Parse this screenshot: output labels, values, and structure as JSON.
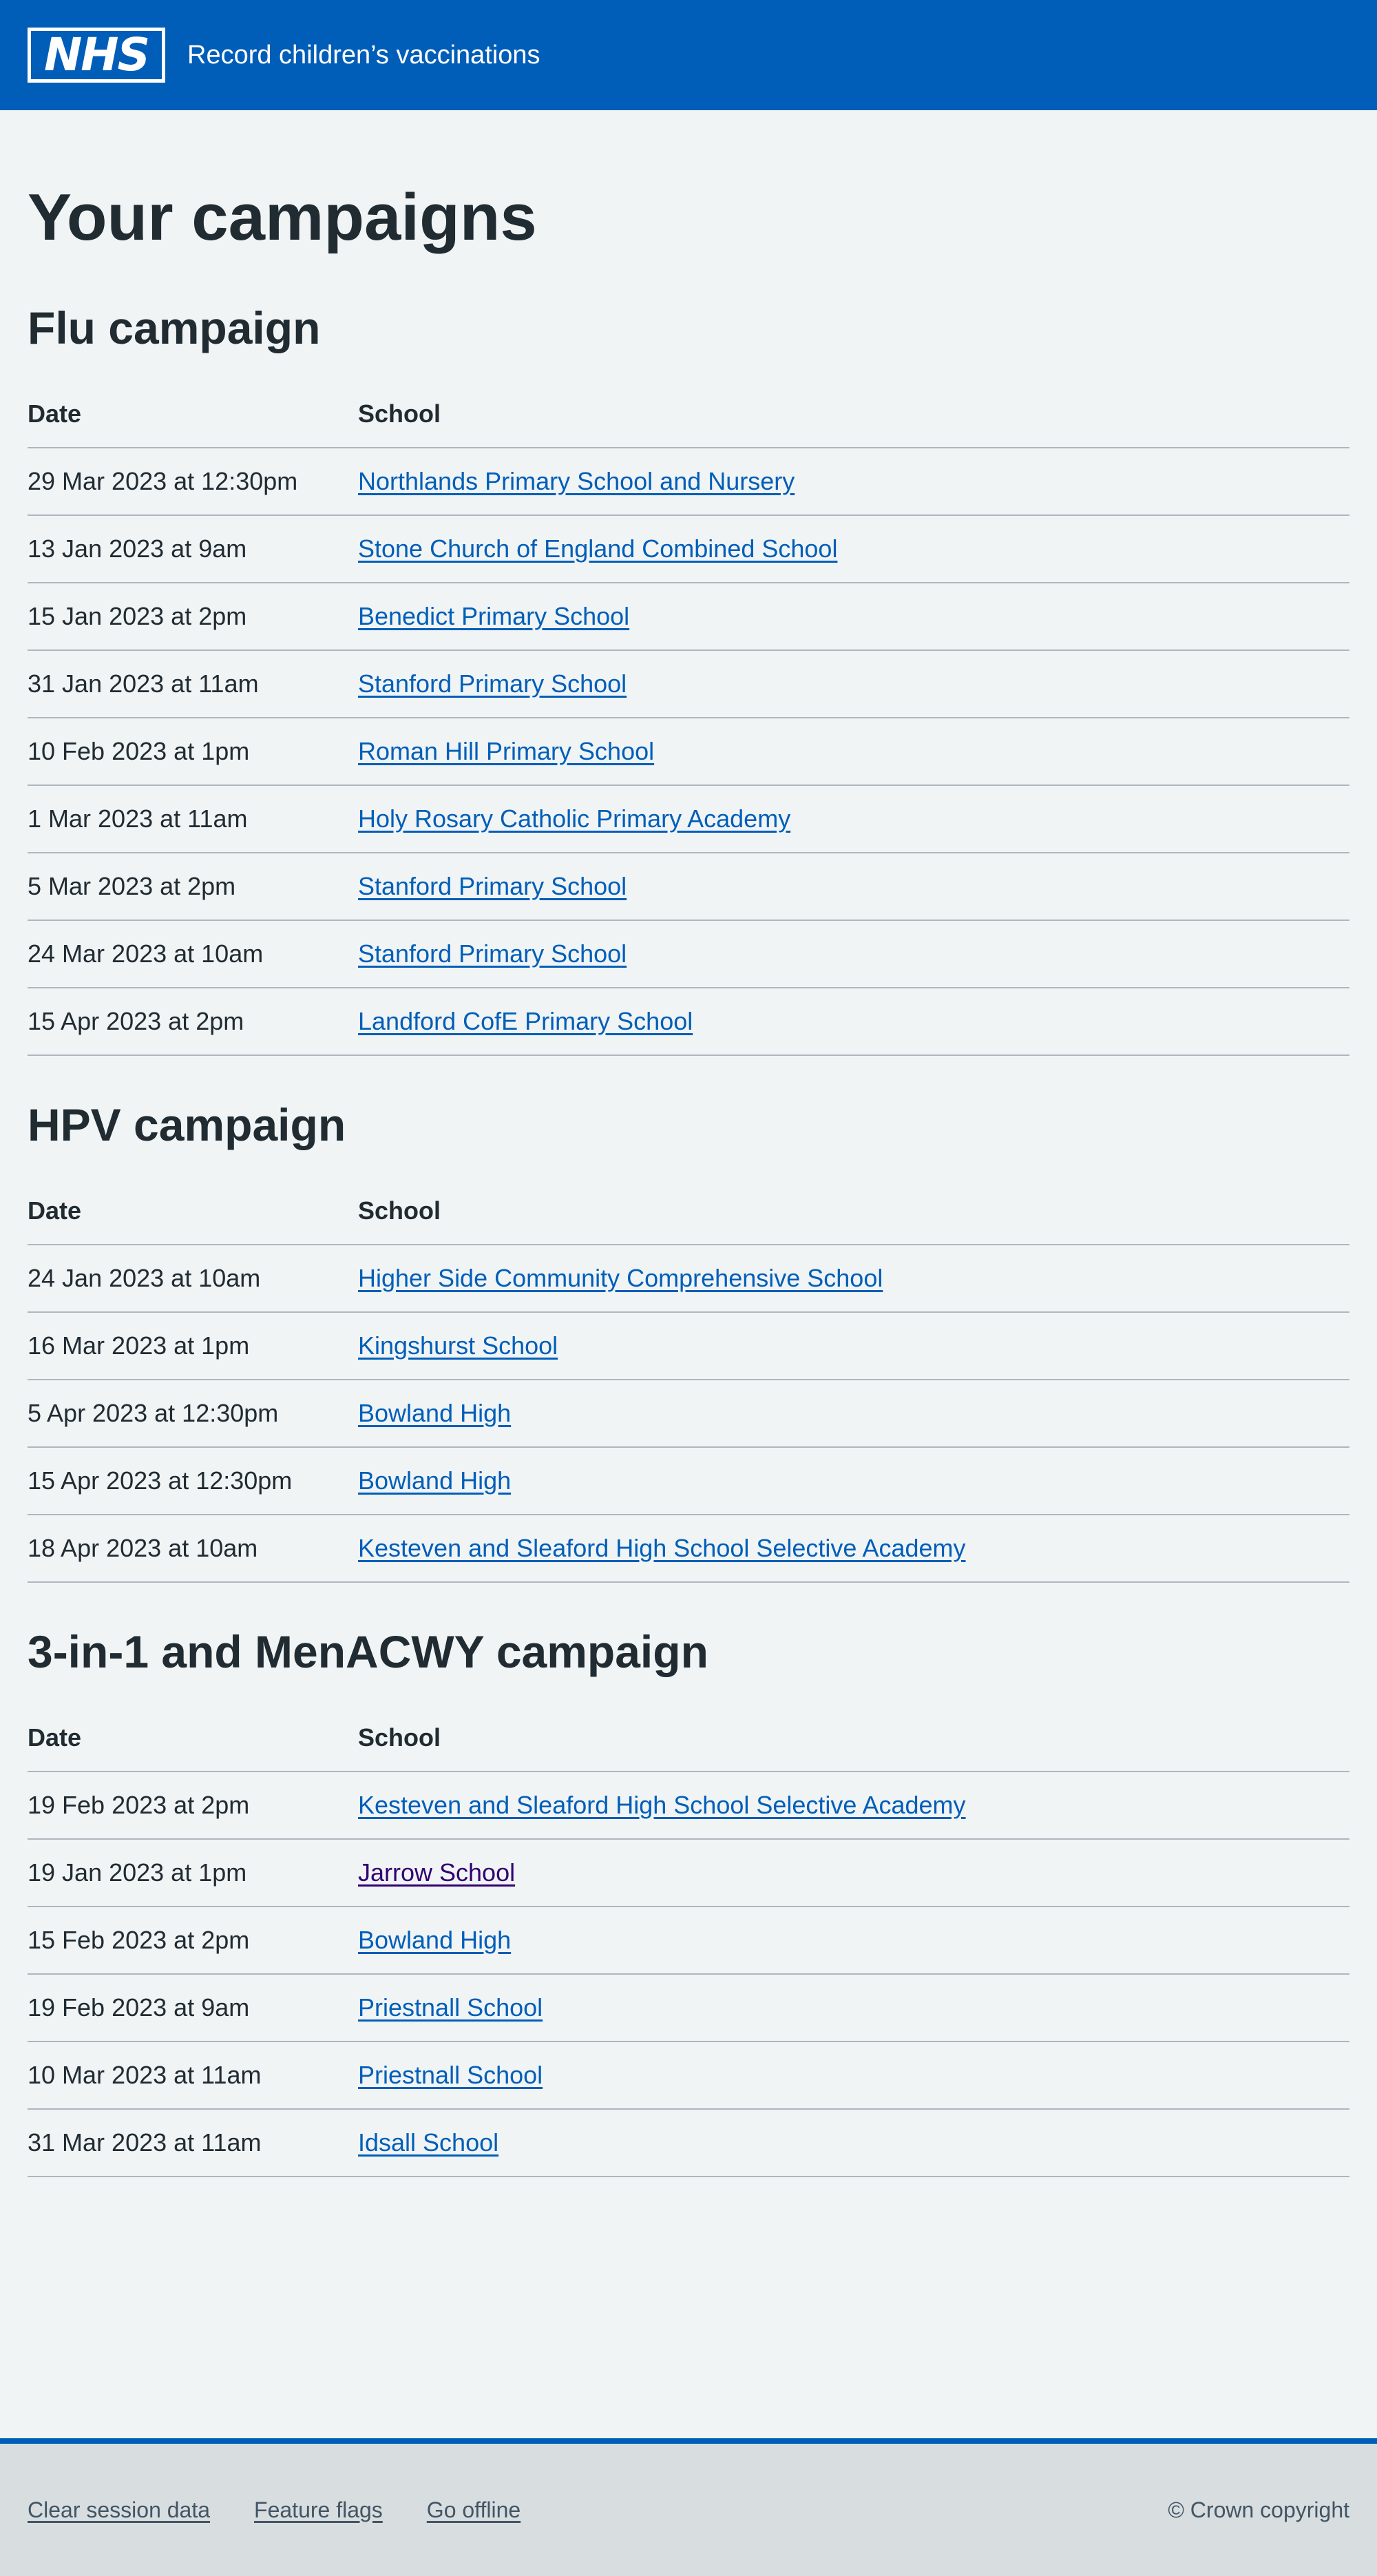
{
  "header": {
    "logo_text": "NHS",
    "service_name": "Record children’s vaccinations",
    "colors": {
      "brand": "#005eb8"
    }
  },
  "page_title": "Your campaigns",
  "table_headers": {
    "date": "Date",
    "school": "School"
  },
  "campaigns": [
    {
      "title": "Flu campaign",
      "rows": [
        {
          "date": "29 Mar 2023 at 12:30pm",
          "school": "Northlands Primary School and Nursery"
        },
        {
          "date": "13 Jan 2023 at 9am",
          "school": "Stone Church of England Combined School"
        },
        {
          "date": "15 Jan 2023 at 2pm",
          "school": "Benedict Primary School"
        },
        {
          "date": "31 Jan 2023 at 11am",
          "school": "Stanford Primary School"
        },
        {
          "date": "10 Feb 2023 at 1pm",
          "school": "Roman Hill Primary School"
        },
        {
          "date": "1 Mar 2023 at 11am",
          "school": "Holy Rosary Catholic Primary Academy"
        },
        {
          "date": "5 Mar 2023 at 2pm",
          "school": "Stanford Primary School"
        },
        {
          "date": "24 Mar 2023 at 10am",
          "school": "Stanford Primary School"
        },
        {
          "date": "15 Apr 2023 at 2pm",
          "school": "Landford CofE Primary School"
        }
      ]
    },
    {
      "title": "HPV campaign",
      "rows": [
        {
          "date": "24 Jan 2023 at 10am",
          "school": "Higher Side Community Comprehensive School"
        },
        {
          "date": "16 Mar 2023 at 1pm",
          "school": "Kingshurst School"
        },
        {
          "date": "5 Apr 2023 at 12:30pm",
          "school": "Bowland High"
        },
        {
          "date": "15 Apr 2023 at 12:30pm",
          "school": "Bowland High"
        },
        {
          "date": "18 Apr 2023 at 10am",
          "school": "Kesteven and Sleaford High School Selective Academy"
        }
      ]
    },
    {
      "title": "3-in-1 and MenACWY campaign",
      "rows": [
        {
          "date": "19 Feb 2023 at 2pm",
          "school": "Kesteven and Sleaford High School Selective Academy"
        },
        {
          "date": "19 Jan 2023 at 1pm",
          "school": "Jarrow School",
          "visited": true
        },
        {
          "date": "15 Feb 2023 at 2pm",
          "school": "Bowland High"
        },
        {
          "date": "19 Feb 2023 at 9am",
          "school": "Priestnall School"
        },
        {
          "date": "10 Mar 2023 at 11am",
          "school": "Priestnall School"
        },
        {
          "date": "31 Mar 2023 at 11am",
          "school": "Idsall School"
        }
      ]
    }
  ],
  "footer": {
    "links": [
      "Clear session data",
      "Feature flags",
      "Go offline"
    ],
    "copyright": "© Crown copyright"
  }
}
